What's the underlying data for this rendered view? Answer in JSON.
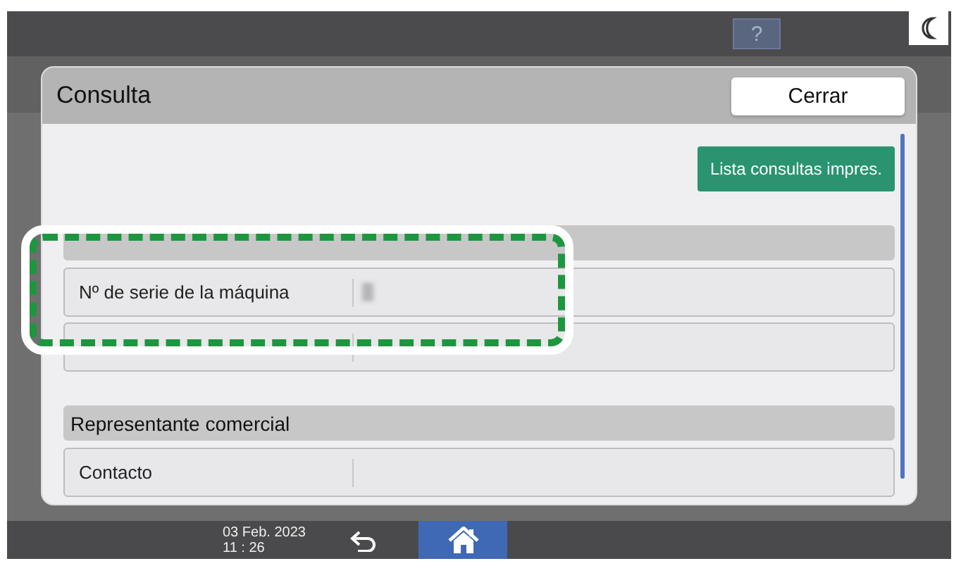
{
  "top_bar": {
    "help_button": "?"
  },
  "dialog": {
    "title": "Consulta",
    "close_button": "Cerrar",
    "action_button": "Lista consultas impres.",
    "sections": [
      {
        "rows": [
          {
            "kind": "redacted",
            "label": "Nº de serie de la máquina"
          },
          {
            "kind": "blank"
          }
        ]
      },
      {
        "heading": "Representante comercial",
        "rows": [
          {
            "kind": "text",
            "label": "Contacto"
          }
        ]
      }
    ]
  },
  "bottom_bar": {
    "date": "03 Feb. 2023",
    "time": "11 : 26",
    "buttons": [
      {
        "kind": "back",
        "selected": false
      },
      {
        "kind": "home",
        "selected": true
      }
    ]
  }
}
